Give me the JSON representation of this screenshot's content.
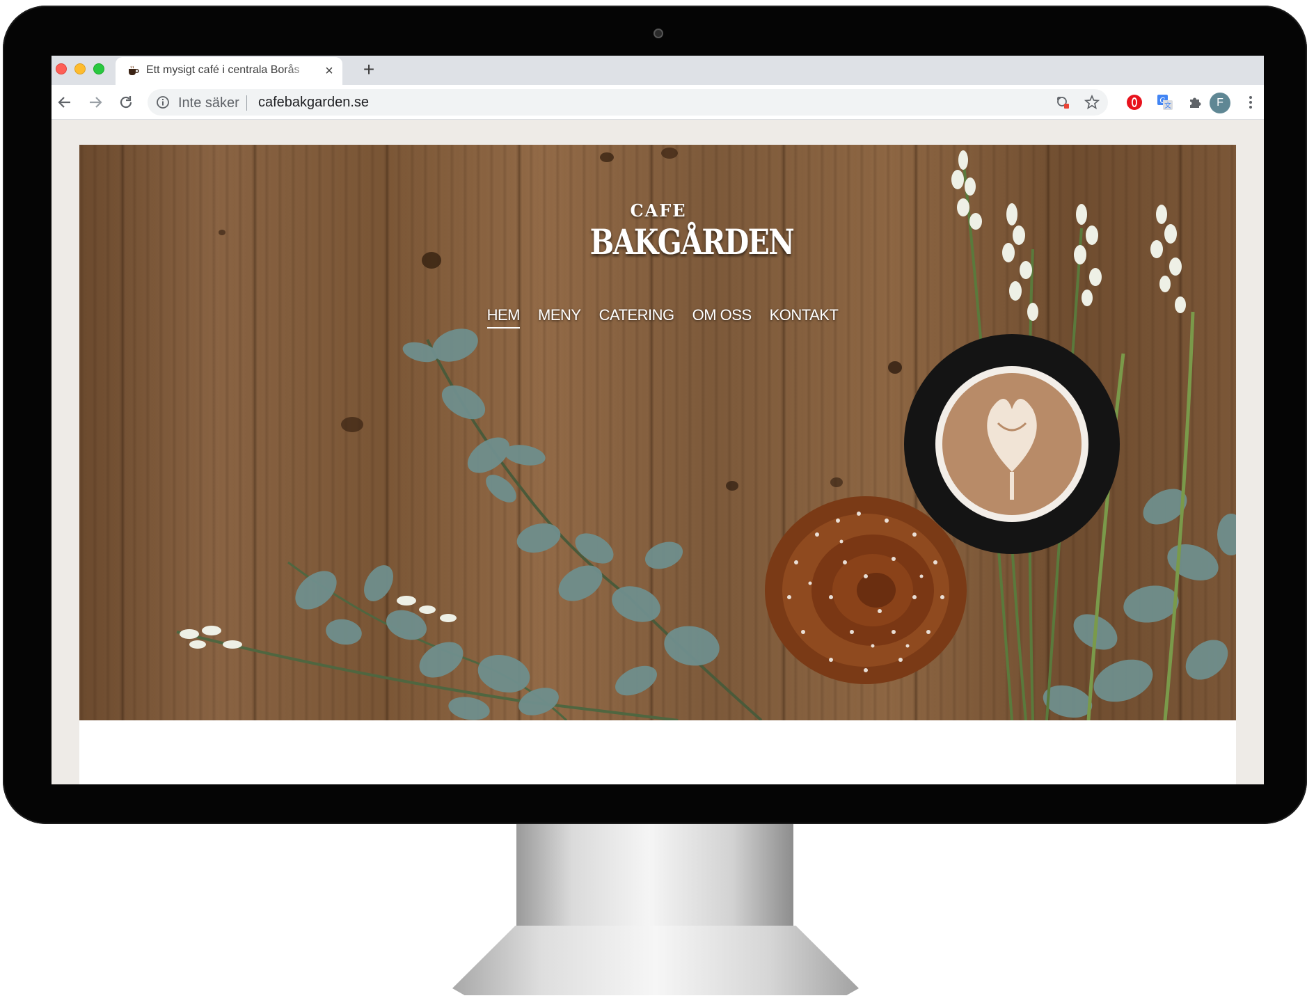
{
  "browser": {
    "tab_title": "Ett mysigt café i centrala Borås",
    "tab_close": "×",
    "new_tab": "+",
    "security_label": "Inte säker",
    "url": "cafebakgarden.se",
    "profile_initial": "F"
  },
  "site": {
    "logo_top": "CAFE",
    "logo_name": "BAKGÅRDEN",
    "nav": [
      {
        "label": "HEM"
      },
      {
        "label": "MENY"
      },
      {
        "label": "CATERING"
      },
      {
        "label": "OM OSS"
      },
      {
        "label": "KONTAKT"
      }
    ]
  },
  "colors": {
    "traffic_red": "#fe5f57",
    "traffic_yellow": "#febc2e",
    "traffic_green": "#28c840",
    "page_background": "#eeebe7",
    "nav_text": "#ffffff"
  },
  "icons": {
    "back": "arrow-left-icon",
    "forward": "arrow-right-icon",
    "reload": "reload-icon",
    "info": "info-icon",
    "lens": "google-lens-icon",
    "bookmark": "star-icon",
    "opera": "opera-extension-icon",
    "translate": "translate-extension-icon",
    "extensions": "puzzle-icon",
    "menu": "kebab-menu-icon"
  }
}
